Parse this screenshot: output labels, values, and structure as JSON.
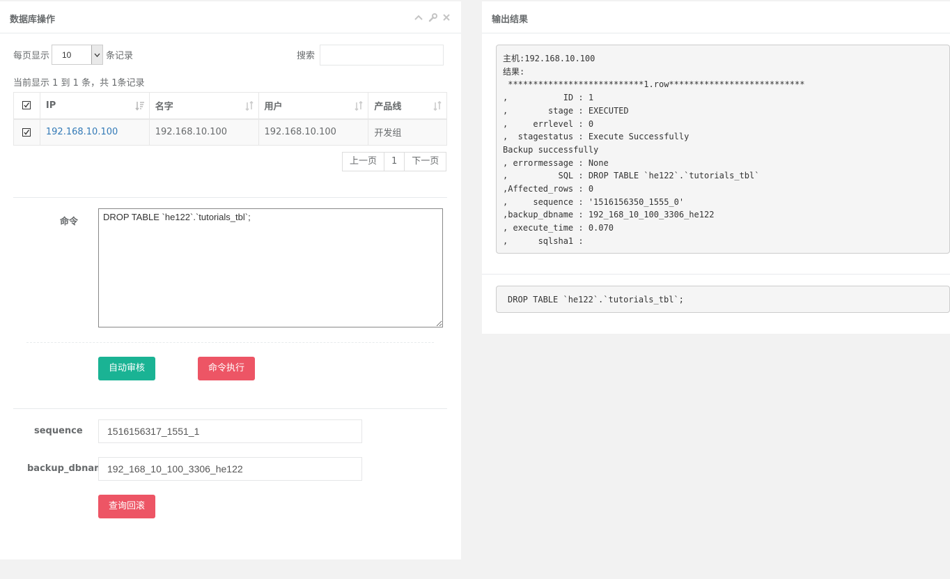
{
  "left_panel": {
    "title": "数据库操作",
    "icons": [
      "chevron-up-icon",
      "wrench-icon",
      "close-icon"
    ]
  },
  "right_panel": {
    "title": "输出结果"
  },
  "table_controls": {
    "per_page_label": "每页显示",
    "page_size": "10",
    "records_label": "条记录",
    "search_label": "搜索",
    "search_value": "",
    "info": "当前显示 1 到 1 条，共 1条记录"
  },
  "table": {
    "columns": [
      "IP",
      "名字",
      "用户",
      "产品线"
    ],
    "rows": [
      {
        "checked": true,
        "ip": "192.168.10.100",
        "name": "192.168.10.100",
        "user": "192.168.10.100",
        "product_line": "开发组"
      }
    ]
  },
  "pagination": {
    "prev": "上一页",
    "current": "1",
    "next": "下一页"
  },
  "command": {
    "label": "命令",
    "value": "DROP TABLE `he122`.`tutorials_tbl`;"
  },
  "buttons": {
    "auto_review": "自动审核",
    "execute": "命令执行",
    "query_rollback": "查询回滚"
  },
  "form": {
    "sequence_label": "sequence",
    "sequence_value": "1516156317_1551_1",
    "backup_dbname_label": "backup_dbname",
    "backup_dbname_value": "192_168_10_100_3306_he122"
  },
  "output": {
    "text": "主机:192.168.10.100\n结果:\n ***************************1.row***************************\n,           ID : 1\n,        stage : EXECUTED\n,     errlevel : 0\n,  stagestatus : Execute Successfully\nBackup successfully\n, errormessage : None\n,          SQL : DROP TABLE `he122`.`tutorials_tbl`\n,Affected_rows : 0\n,     sequence : '1516156350_1555_0'\n,backup_dbname : 192_168_10_100_3306_he122\n, execute_time : 0.070\n,      sqlsha1 :",
    "sql": "DROP TABLE `he122`.`tutorials_tbl`;"
  },
  "colors": {
    "primary": "#1ab394",
    "danger": "#ed5565",
    "link": "#337ab7"
  }
}
